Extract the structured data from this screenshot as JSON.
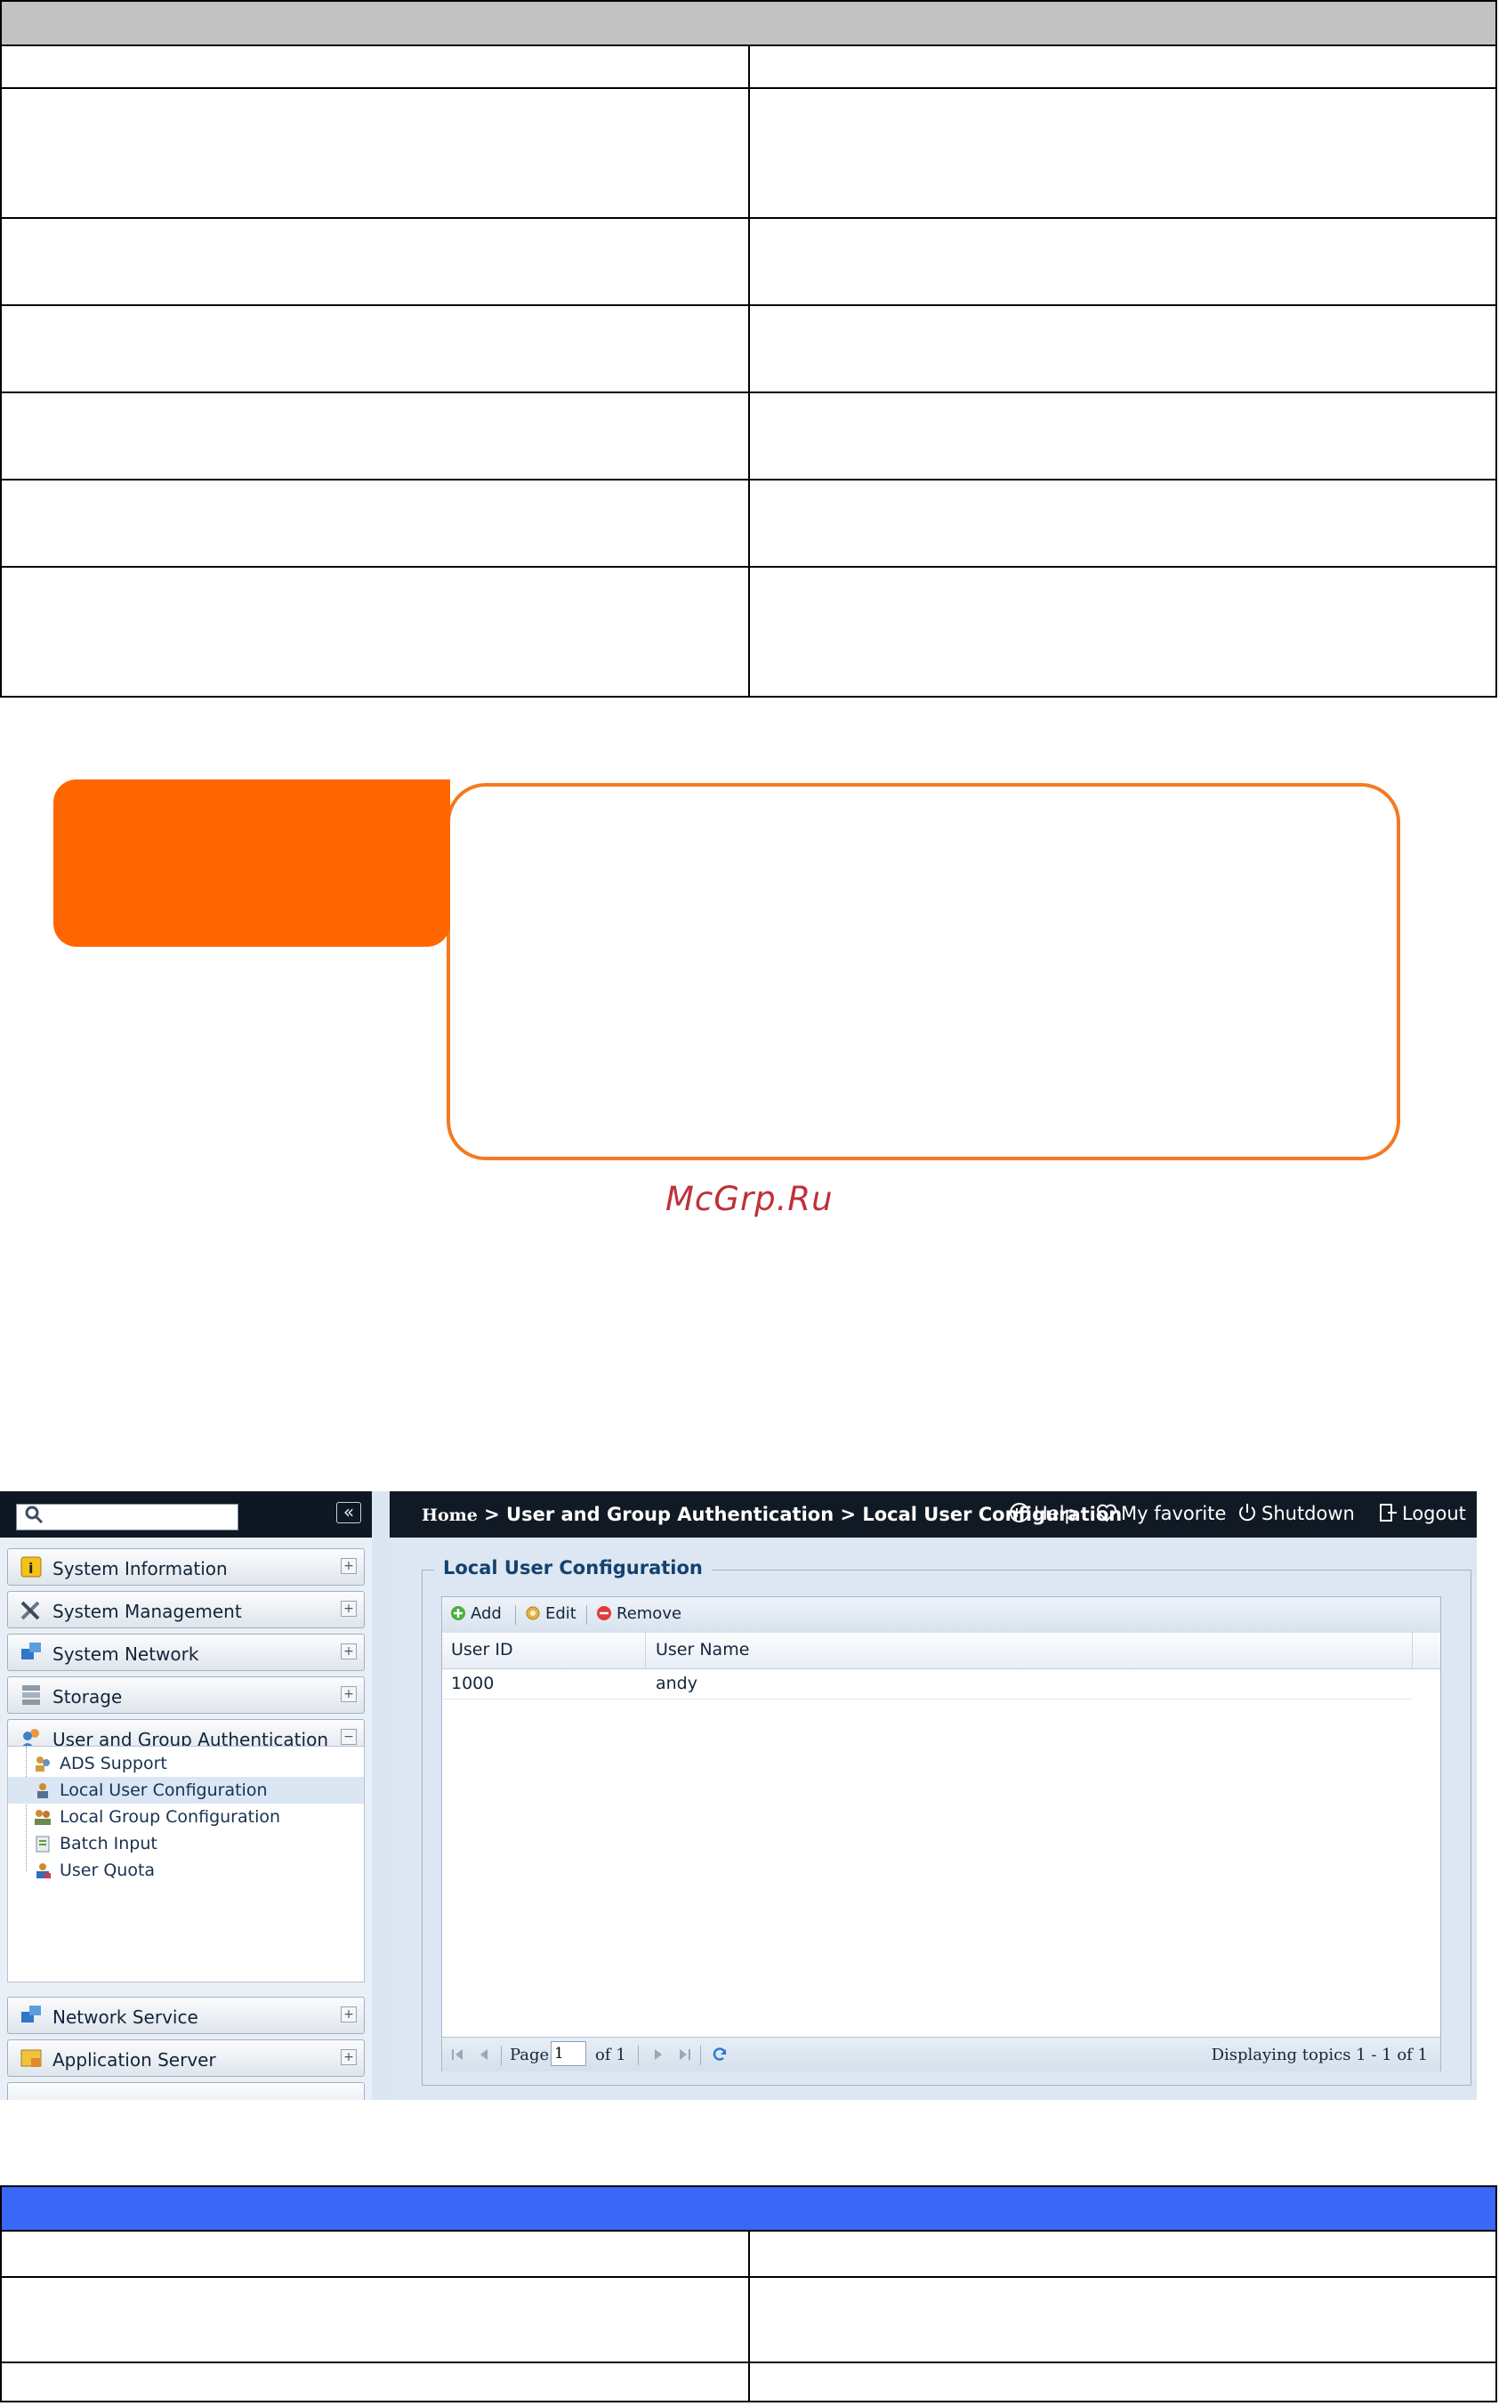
{
  "screenshot": {
    "sidebar": {
      "search": {
        "placeholder": ""
      },
      "menu": [
        {
          "label": "System Information",
          "icon": "info-icon",
          "expanded": false
        },
        {
          "label": "System Management",
          "icon": "tools-icon",
          "expanded": false
        },
        {
          "label": "System Network",
          "icon": "network-icon",
          "expanded": false
        },
        {
          "label": "Storage",
          "icon": "storage-icon",
          "expanded": false
        },
        {
          "label": "User and Group Authentication",
          "icon": "users-icon",
          "expanded": true
        },
        {
          "label": "Network Service",
          "icon": "network-service-icon",
          "expanded": false
        },
        {
          "label": "Application Server",
          "icon": "application-server-icon",
          "expanded": false
        }
      ],
      "submenu": [
        {
          "label": "ADS Support",
          "icon": "ads-icon",
          "selected": false
        },
        {
          "label": "Local User Configuration",
          "icon": "local-user-icon",
          "selected": true
        },
        {
          "label": "Local Group Configuration",
          "icon": "local-group-icon",
          "selected": false
        },
        {
          "label": "Batch Input",
          "icon": "batch-input-icon",
          "selected": false
        },
        {
          "label": "User Quota",
          "icon": "user-quota-icon",
          "selected": false
        }
      ]
    },
    "topbar": {
      "breadcrumb_home": "Home",
      "breadcrumb_rest": " > User and Group Authentication > Local User Configuration",
      "help": "Help",
      "favorite": "My favorite",
      "shutdown": "Shutdown",
      "logout": "Logout"
    },
    "panel": {
      "title": "Local User Configuration",
      "toolbar": {
        "add": "Add",
        "edit": "Edit",
        "remove": "Remove"
      },
      "columns": [
        "User ID",
        "User Name"
      ],
      "rows": [
        {
          "user_id": "1000",
          "user_name": "andy"
        }
      ],
      "pager": {
        "page_label": "Page",
        "page_value": "1",
        "of_label": "of 1",
        "status": "Displaying topics 1 - 1 of 1"
      }
    }
  },
  "watermark": "McGrp.Ru",
  "colors": {
    "table1_header": "#c2c2c2",
    "table2_header": "#3a67f5",
    "note_accent": "#ff6600"
  }
}
